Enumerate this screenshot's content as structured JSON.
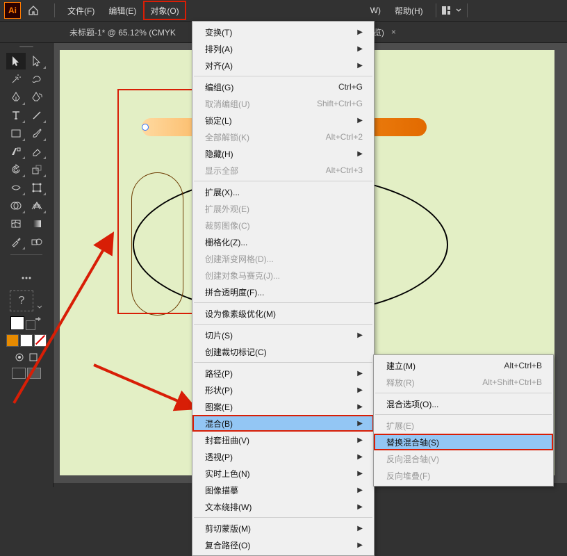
{
  "app": {
    "badge": "Ai"
  },
  "menubar": {
    "file": "文件(F)",
    "edit": "编辑(E)",
    "object": "对象(O)",
    "tail_w": "W)",
    "help": "帮助(H)"
  },
  "doc": {
    "title_left": "未标题-1* @ 65.12% (CMYK",
    "title_right": "B/CPU 预览)",
    "close_x": "×"
  },
  "question_mark": "?",
  "object_menu": [
    {
      "label": "变换(T)",
      "sub": true
    },
    {
      "label": "排列(A)",
      "sub": true
    },
    {
      "label": "对齐(A)",
      "sub": true
    },
    {
      "sep": true
    },
    {
      "label": "编组(G)",
      "kbd": "Ctrl+G"
    },
    {
      "label": "取消编组(U)",
      "kbd": "Shift+Ctrl+G",
      "disabled": true
    },
    {
      "label": "锁定(L)",
      "sub": true
    },
    {
      "label": "全部解锁(K)",
      "kbd": "Alt+Ctrl+2",
      "disabled": true
    },
    {
      "label": "隐藏(H)",
      "sub": true
    },
    {
      "label": "显示全部",
      "kbd": "Alt+Ctrl+3",
      "disabled": true
    },
    {
      "sep": true
    },
    {
      "label": "扩展(X)..."
    },
    {
      "label": "扩展外观(E)",
      "disabled": true
    },
    {
      "label": "裁剪图像(C)",
      "disabled": true
    },
    {
      "label": "栅格化(Z)..."
    },
    {
      "label": "创建渐变网格(D)...",
      "disabled": true
    },
    {
      "label": "创建对象马赛克(J)...",
      "disabled": true
    },
    {
      "label": "拼合透明度(F)..."
    },
    {
      "sep": true
    },
    {
      "label": "设为像素级优化(M)"
    },
    {
      "sep": true
    },
    {
      "label": "切片(S)",
      "sub": true
    },
    {
      "label": "创建裁切标记(C)"
    },
    {
      "sep": true
    },
    {
      "label": "路径(P)",
      "sub": true
    },
    {
      "label": "形状(P)",
      "sub": true
    },
    {
      "label": "图案(E)",
      "sub": true
    },
    {
      "label": "混合(B)",
      "sub": true,
      "boxed": true,
      "hl": true
    },
    {
      "label": "封套扭曲(V)",
      "sub": true
    },
    {
      "label": "透视(P)",
      "sub": true
    },
    {
      "label": "实时上色(N)",
      "sub": true
    },
    {
      "label": "图像描摹",
      "sub": true
    },
    {
      "label": "文本绕排(W)",
      "sub": true
    },
    {
      "sep": true
    },
    {
      "label": "剪切蒙版(M)",
      "sub": true
    },
    {
      "label": "复合路径(O)",
      "sub": true
    }
  ],
  "blend_submenu": [
    {
      "label": "建立(M)",
      "kbd": "Alt+Ctrl+B"
    },
    {
      "label": "释放(R)",
      "kbd": "Alt+Shift+Ctrl+B",
      "disabled": true
    },
    {
      "sep": true
    },
    {
      "label": "混合选项(O)..."
    },
    {
      "sep": true
    },
    {
      "label": "扩展(E)",
      "disabled": true
    },
    {
      "label": "替换混合轴(S)",
      "hl": true,
      "boxed": true
    },
    {
      "label": "反向混合轴(V)",
      "disabled": true
    },
    {
      "label": "反向堆叠(F)",
      "disabled": true
    }
  ]
}
